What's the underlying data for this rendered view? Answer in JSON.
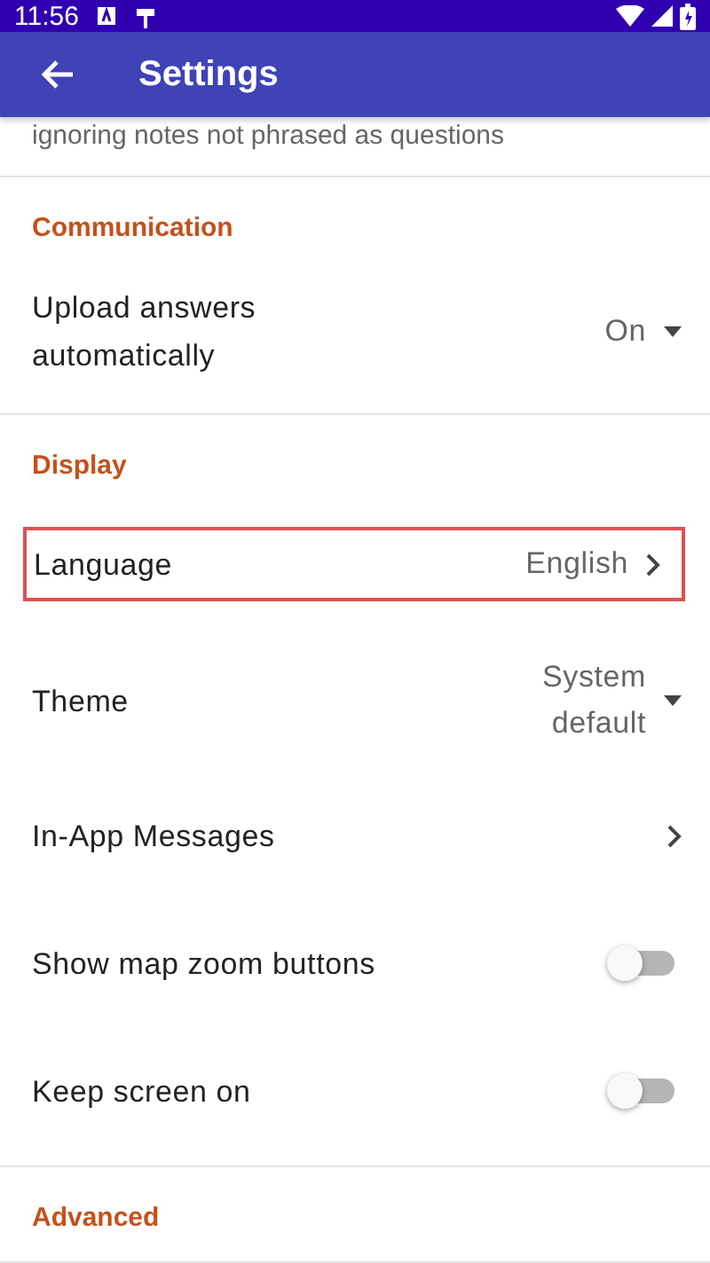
{
  "status_bar": {
    "time": "11:56"
  },
  "app_bar": {
    "title": "Settings"
  },
  "previous_summary": "ignoring notes not phrased as questions",
  "sections": [
    {
      "title": "Communication",
      "items": [
        {
          "kind": "dropdown",
          "label": "Upload answers automatically",
          "value": "On",
          "highlighted": false
        }
      ]
    },
    {
      "title": "Display",
      "items": [
        {
          "kind": "link",
          "label": "Language",
          "value": "English",
          "highlighted": true
        },
        {
          "kind": "dropdown",
          "label": "Theme",
          "value": "System default",
          "highlighted": false
        },
        {
          "kind": "link",
          "label": "In-App Messages",
          "highlighted": false
        },
        {
          "kind": "switch",
          "label": "Show map zoom buttons",
          "on": false,
          "highlighted": false
        },
        {
          "kind": "switch",
          "label": "Keep screen on",
          "on": false,
          "highlighted": false
        }
      ]
    },
    {
      "title": "Advanced"
    }
  ]
}
